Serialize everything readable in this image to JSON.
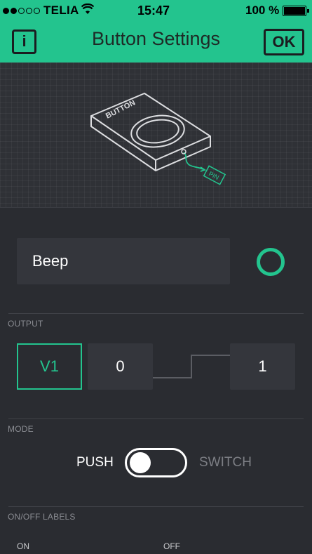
{
  "status_bar": {
    "carrier": "TELIA",
    "time": "15:47",
    "battery": "100 %",
    "battery_level": 1.0,
    "signal_bars_filled": 2,
    "signal_bars_total": 5
  },
  "header": {
    "info_label": "i",
    "title": "Button Settings",
    "ok_label": "OK"
  },
  "illustration": {
    "device_label": "BUTTON",
    "pin_label": "PIN"
  },
  "widget": {
    "name_value": "Beep"
  },
  "output": {
    "section_label": "OUTPUT",
    "pin": "V1",
    "low_value": "0",
    "high_value": "1"
  },
  "mode": {
    "section_label": "MODE",
    "push_label": "PUSH",
    "switch_label": "SWITCH",
    "selected": "PUSH"
  },
  "onoff_labels": {
    "section_label": "ON/OFF LABELS",
    "on_label": "ON",
    "off_label": "OFF"
  },
  "colors": {
    "accent": "#23c48e",
    "background": "#2a2c31",
    "field": "#34363c"
  }
}
